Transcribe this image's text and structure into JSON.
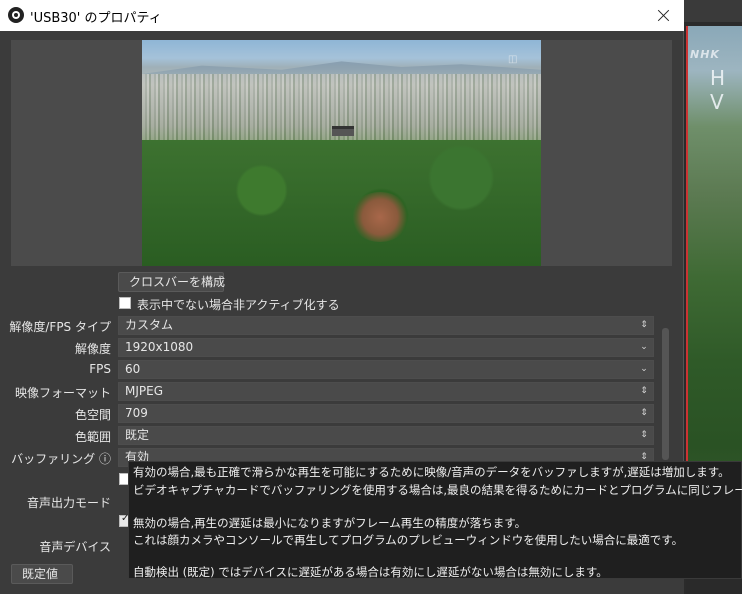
{
  "window": {
    "title": "'USB30' のプロパティ",
    "close_glyph": "✕"
  },
  "background": {
    "nhk_text": "NHK",
    "hv_text": "H V"
  },
  "crossbar_button": "クロスバーを構成",
  "deactivate_checkbox": {
    "label": "表示中でない場合非アクティブ化する",
    "checked": false
  },
  "rows": [
    {
      "label": "解像度/FPS タイプ",
      "value": "カスタム",
      "arrow": "⌃⌄"
    },
    {
      "label": "解像度",
      "value": "1920x1080",
      "arrow": "⌄"
    },
    {
      "label": "FPS",
      "value": "60",
      "arrow": "⌄"
    },
    {
      "label": "映像フォーマット",
      "value": "MJPEG",
      "arrow": "⌃⌄"
    },
    {
      "label": "色空間",
      "value": "709",
      "arrow": "⌃⌄"
    },
    {
      "label": "色範囲",
      "value": "既定",
      "arrow": "⌃⌄"
    },
    {
      "label": "バッファリング ⓘ",
      "value": "有効",
      "arrow": "⌃⌄"
    }
  ],
  "partial_labels": {
    "audio_output_mode": "音声出力モード",
    "audio_device": "音声デバイス"
  },
  "defaults_button": "既定値",
  "tooltip": {
    "line1": "有効の場合,最も正確で滑らかな再生を可能にするために映像/音声のデータをバッファしますが,遅延は増加します。",
    "line2": "ビデオキャプチャカードでバッファリングを使用する場合は,最良の結果を得るためにカードとプログラムに同じフレームレートを設定することを推奨します。",
    "line3": "無効の場合,再生の遅延は最小になりますがフレーム再生の精度が落ちます。",
    "line4": "これは顔カメラやコンソールで再生してプログラムのプレビューウィンドウを使用したい場合に最適です。",
    "line5": "自動検出 (既定) ではデバイスに遅延がある場合は有効にし遅延がない場合は無効にします。"
  }
}
